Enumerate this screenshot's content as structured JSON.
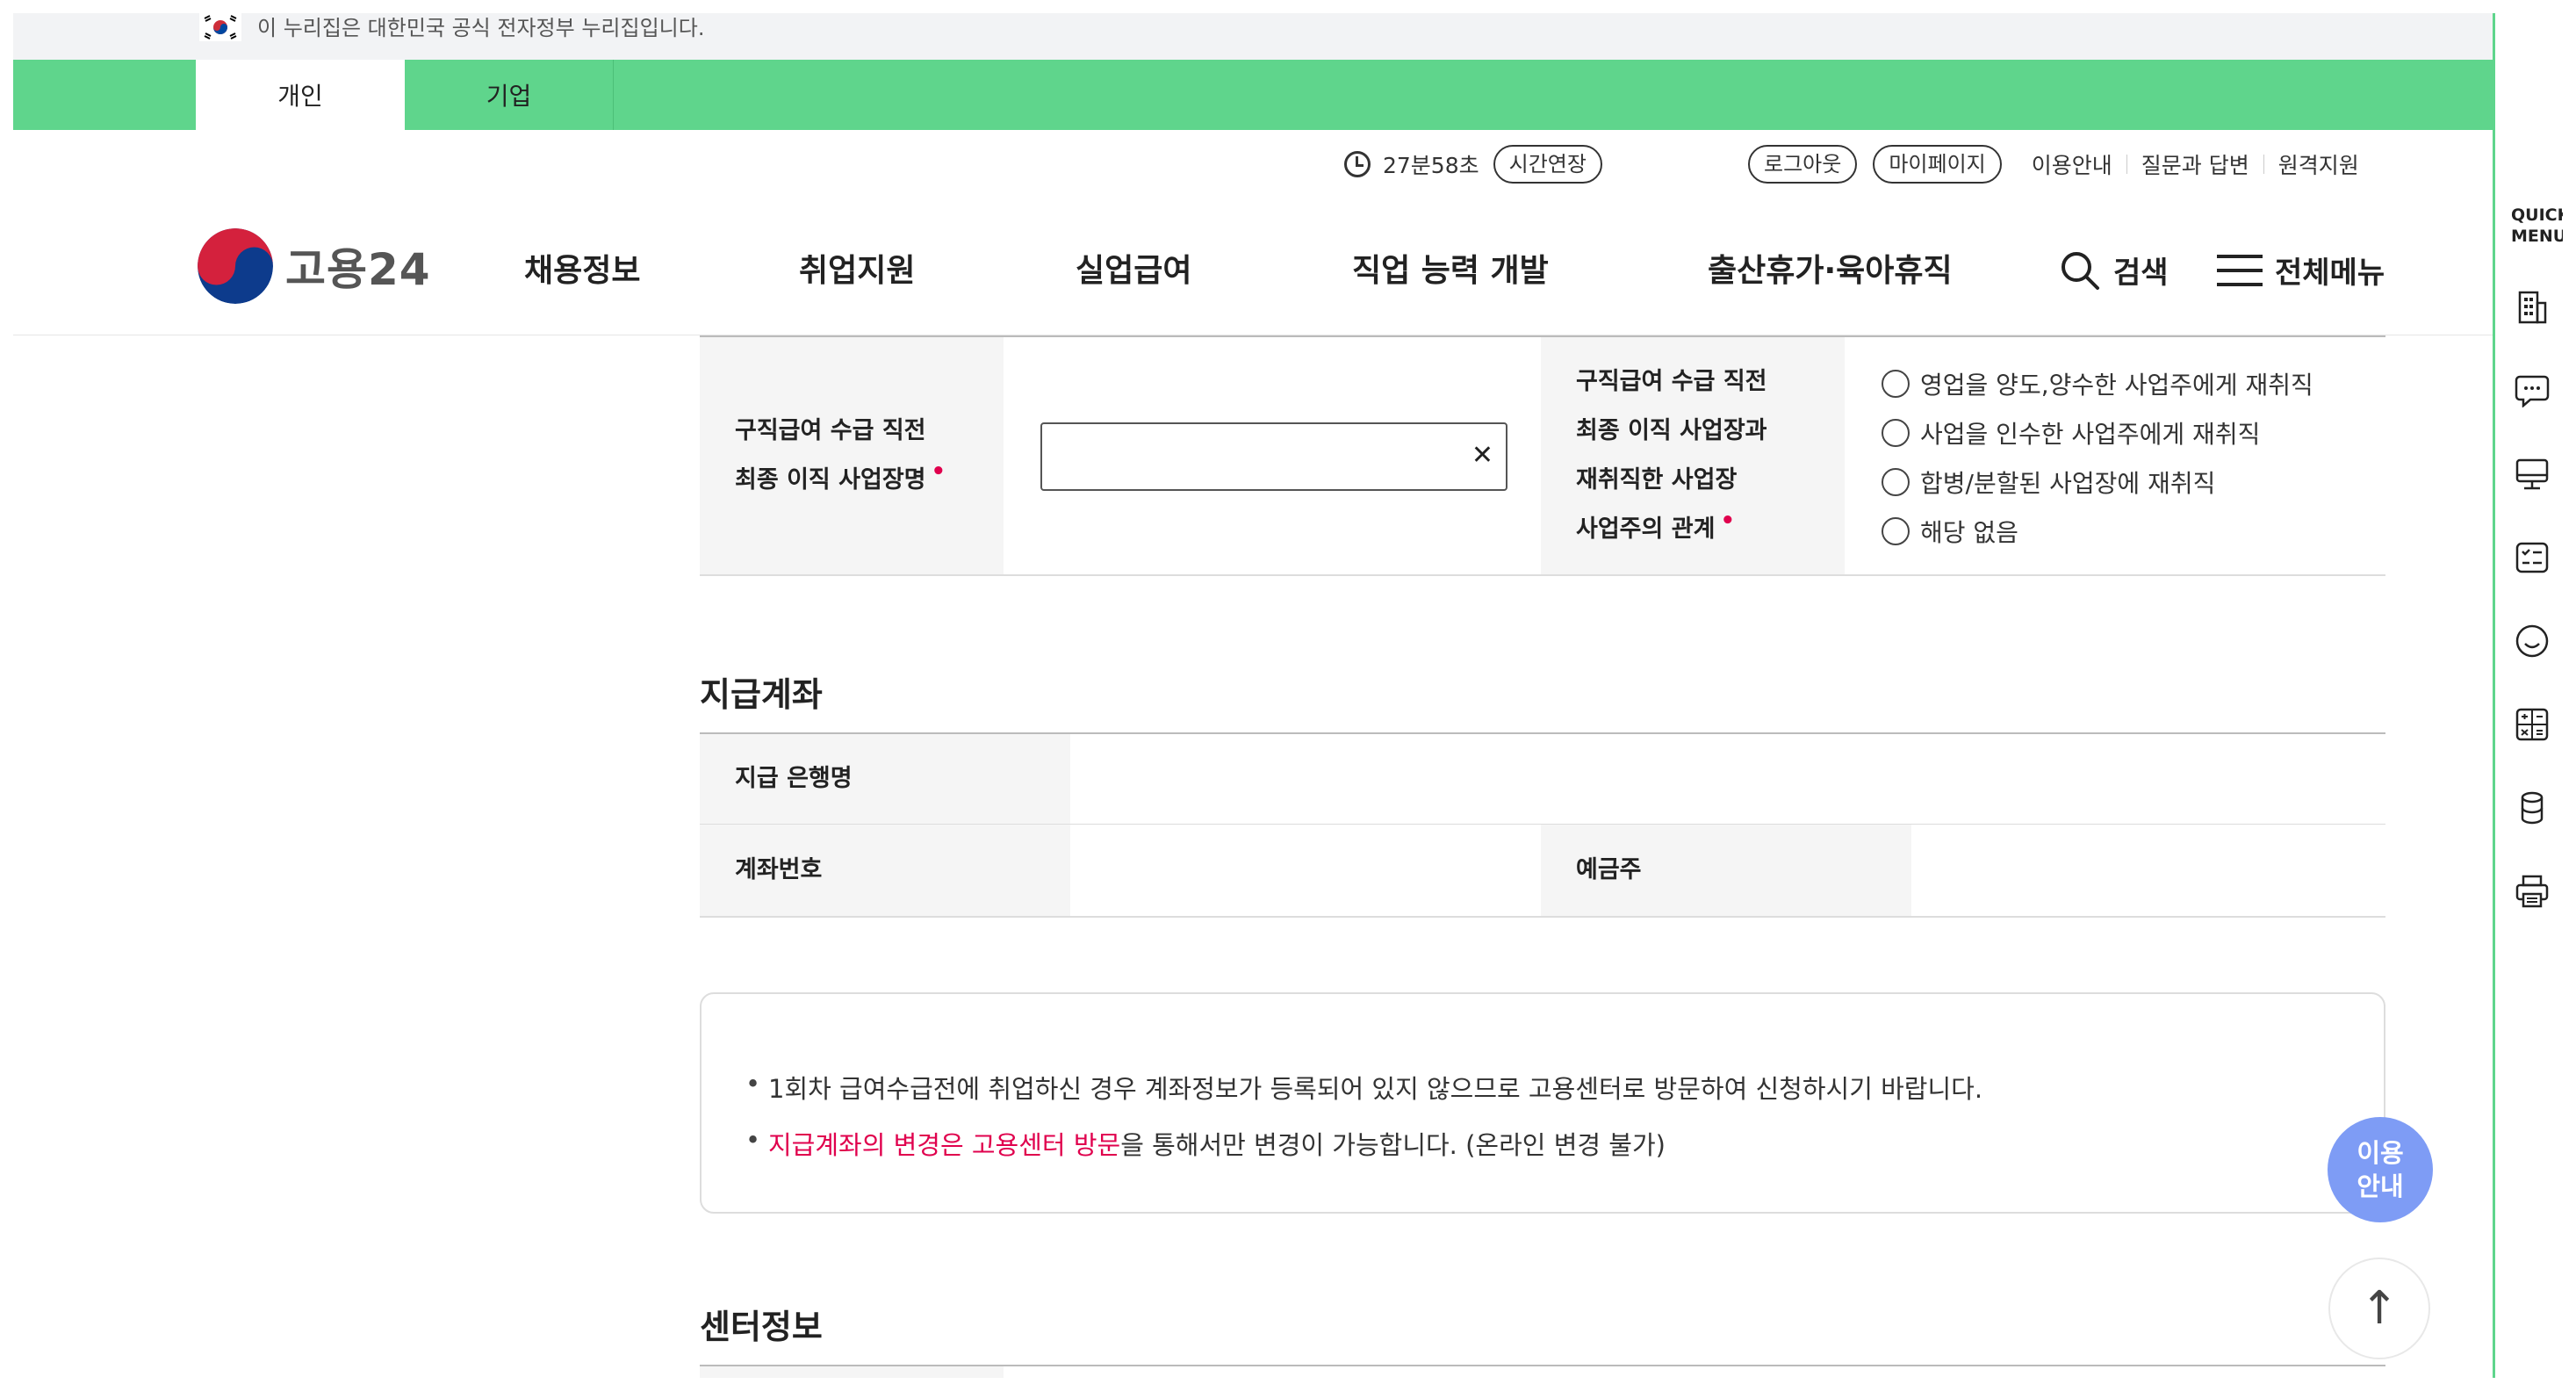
{
  "gov_banner": {
    "text": "이 누리집은 대한민국 공식 전자정부 누리집입니다."
  },
  "segments": [
    {
      "label": "개인",
      "active": true
    },
    {
      "label": "기업",
      "active": false
    }
  ],
  "util": {
    "timer": "27분58초",
    "extend": "시간연장",
    "logout": "로그아웃",
    "mypage": "마이페이지",
    "links": [
      "이용안내",
      "질문과 답변",
      "원격지원"
    ]
  },
  "logo": {
    "text": "고용24"
  },
  "nav": [
    "채용정보",
    "취업지원",
    "실업급여",
    "직업 능력 개발",
    "출산휴가·육아휴직"
  ],
  "search_label": "검색",
  "menu_label": "전체메뉴",
  "form": {
    "last_employer_label_1": "구직급여 수급 직전",
    "last_employer_label_2": "최종 이직 사업장명",
    "last_employer_value": "",
    "relation_label_1": "구직급여 수급 직전",
    "relation_label_2": "최종 이직 사업장과",
    "relation_label_3": "재취직한 사업장",
    "relation_label_4": "사업주의 관계",
    "relation_options": [
      "영업을 양도,양수한 사업주에게 재취직",
      "사업을 인수한 사업주에게 재취직",
      "합병/분할된 사업장에 재취직",
      "해당 없음"
    ],
    "required_mark": "•"
  },
  "account": {
    "title": "지급계좌",
    "bank_label": "지급 은행명",
    "bank_value": "",
    "account_label": "계좌번호",
    "account_value": "",
    "holder_label": "예금주",
    "holder_value": ""
  },
  "notice": {
    "line1": "1회차 급여수급전에 취업하신 경우 계좌정보가 등록되어 있지 않으므로 고용센터로 방문하여 신청하시기 바랍니다.",
    "line2_highlight": "지급계좌의 변경은 고용센터 방문",
    "line2_rest": "을 통해서만 변경이 가능합니다. (온라인 변경 불가)"
  },
  "center": {
    "title": "센터정보"
  },
  "floating": {
    "guide_line1": "이용",
    "guide_line2": "안내",
    "top_arrow": "↑"
  },
  "quick_menu": {
    "title_line1": "QUICK",
    "title_line2": "MENU",
    "icons": [
      "building-icon",
      "chat-icon",
      "monitor-icon",
      "checklist-icon",
      "smile-icon",
      "calculator-icon",
      "coins-icon",
      "printer-icon"
    ]
  },
  "colors": {
    "accent_green": "#5fd58c",
    "required_pink": "#e0004d",
    "fab_blue": "#7e9cf5"
  }
}
